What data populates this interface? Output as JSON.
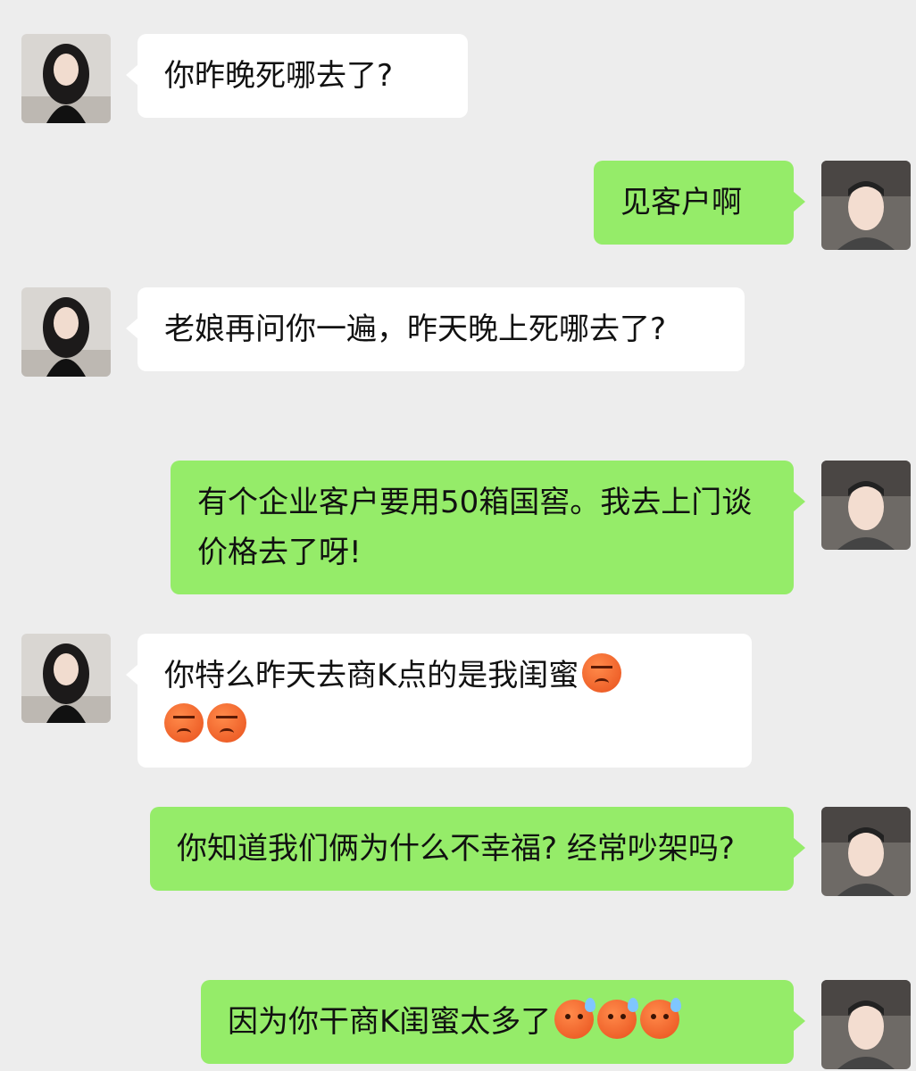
{
  "messages": [
    {
      "side": "left",
      "text": "你昨晚死哪去了?"
    },
    {
      "side": "right",
      "text": "见客户啊"
    },
    {
      "side": "left",
      "text": "老娘再问你一遍，昨天晚上死哪去了?"
    },
    {
      "side": "right",
      "text": "有个企业客户要用50箱国窖。我去上门谈价格去了呀!"
    },
    {
      "side": "left",
      "text": "你特么昨天去商K点的是我闺蜜",
      "emojis": [
        "angry-face-emoji",
        "angry-face-emoji",
        "angry-face-emoji"
      ]
    },
    {
      "side": "right",
      "text": "你知道我们俩为什么不幸福? 经常吵架吗?"
    },
    {
      "side": "right",
      "text": "因为你干商K闺蜜太多了",
      "emojis": [
        "sweat-face-emoji",
        "sweat-face-emoji",
        "sweat-face-emoji"
      ]
    }
  ]
}
